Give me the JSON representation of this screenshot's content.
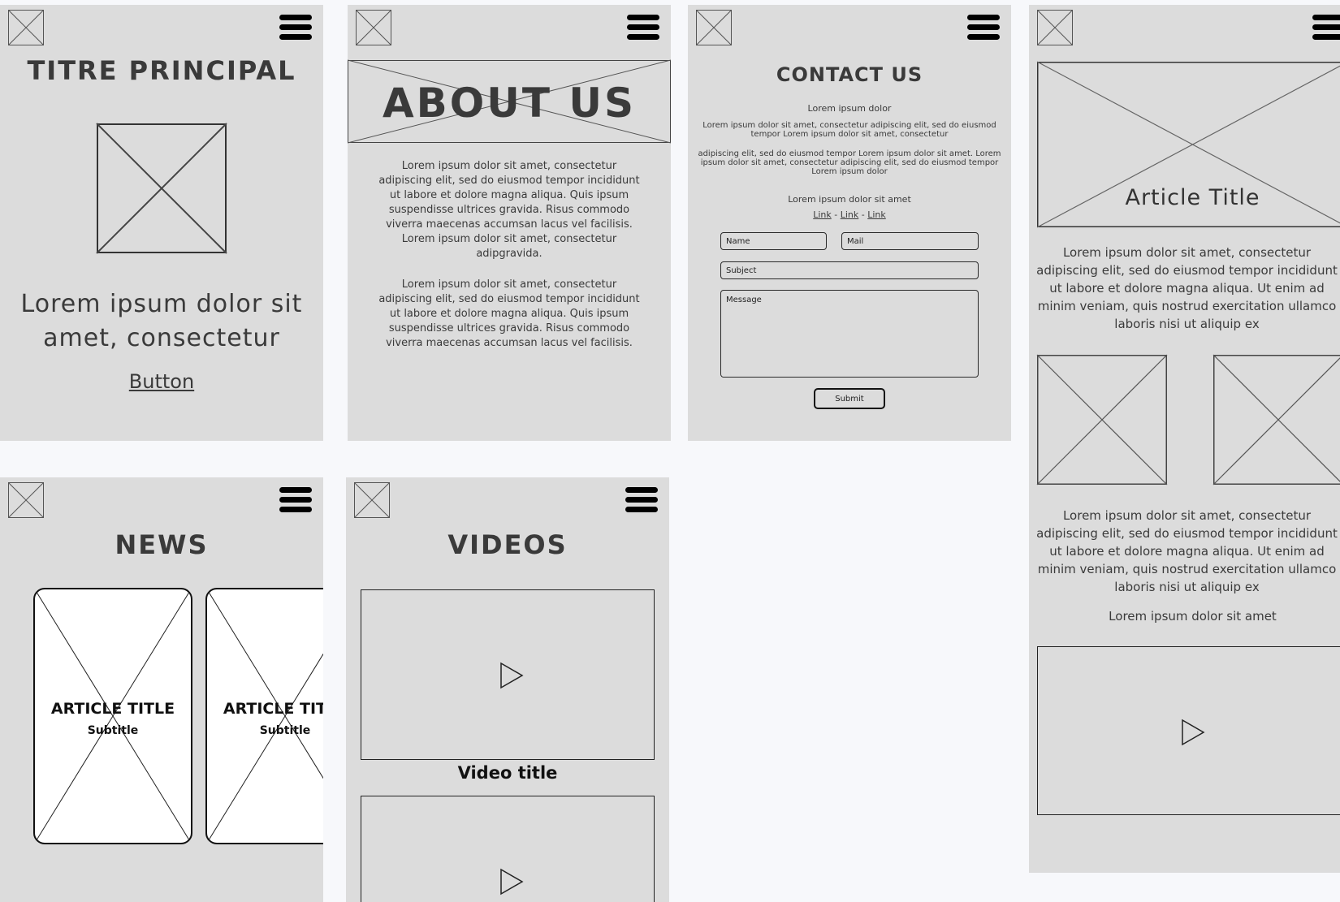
{
  "home": {
    "title": "TITRE PRINCIPAL",
    "body_line1": "Lorem ipsum dolor sit",
    "body_line2": "amet, consectetur",
    "button_label": "Button"
  },
  "about": {
    "title": "ABOUT US",
    "paragraph1": "Lorem ipsum dolor sit amet, consectetur adipiscing elit, sed do eiusmod tempor incididunt ut labore et dolore magna aliqua. Quis ipsum suspendisse ultrices gravida. Risus commodo viverra maecenas accumsan lacus vel facilisis. Lorem ipsum dolor sit amet, consectetur adipgravida.",
    "paragraph2": "Lorem ipsum dolor sit amet, consectetur adipiscing elit, sed do eiusmod tempor incididunt ut labore et dolore magna aliqua. Quis ipsum suspendisse ultrices gravida. Risus commodo viverra maecenas accumsan lacus vel facilisis."
  },
  "contact": {
    "title": "CONTACT US",
    "subtitle": "Lorem ipsum dolor",
    "paragraph1": "Lorem ipsum dolor sit amet, consectetur adipiscing elit, sed do eiusmod tempor Lorem ipsum dolor sit amet, consectetur",
    "paragraph2": "adipiscing elit, sed do eiusmod tempor Lorem ipsum dolor sit amet. Lorem ipsum dolor sit amet, consectetur adipiscing elit, sed do eiusmod tempor Lorem ipsum dolor",
    "links_intro": "Lorem ipsum dolor sit amet",
    "links": [
      "Link",
      "Link",
      "Link"
    ],
    "link_separator": " - ",
    "name_placeholder": "Name",
    "mail_placeholder": "Mail",
    "subject_placeholder": "Subject",
    "message_placeholder": "Message",
    "submit_label": "Submit"
  },
  "article": {
    "title": "Article Title",
    "paragraph1": "Lorem ipsum dolor sit amet, consectetur adipiscing elit, sed do eiusmod tempor incididunt ut labore et dolore magna aliqua. Ut enim ad minim veniam, quis nostrud exercitation ullamco laboris nisi ut aliquip ex",
    "paragraph2": "Lorem ipsum dolor sit amet, consectetur adipiscing elit, sed do eiusmod tempor incididunt ut labore et dolore magna aliqua. Ut enim ad minim veniam, quis nostrud exercitation ullamco laboris nisi ut aliquip ex",
    "caption": "Lorem ipsum dolor sit amet"
  },
  "news": {
    "title": "NEWS",
    "cards": [
      {
        "title": "ARTICLE TITLE",
        "subtitle": "Subtitle"
      },
      {
        "title": "ARTICLE TITLE",
        "subtitle": "Subtitle"
      }
    ]
  },
  "videos": {
    "title": "VIDEOS",
    "video1_title": "Video title"
  },
  "icons": {
    "logo": "logo-placeholder-icon",
    "menu": "hamburger-menu-icon",
    "image": "image-placeholder-icon",
    "play": "play-icon"
  },
  "colors": {
    "page_background": "#f7f8fb",
    "panel_background": "#dcdcdc",
    "text": "#3a3a3a",
    "stroke": "#111111",
    "card_background": "#ffffff"
  }
}
